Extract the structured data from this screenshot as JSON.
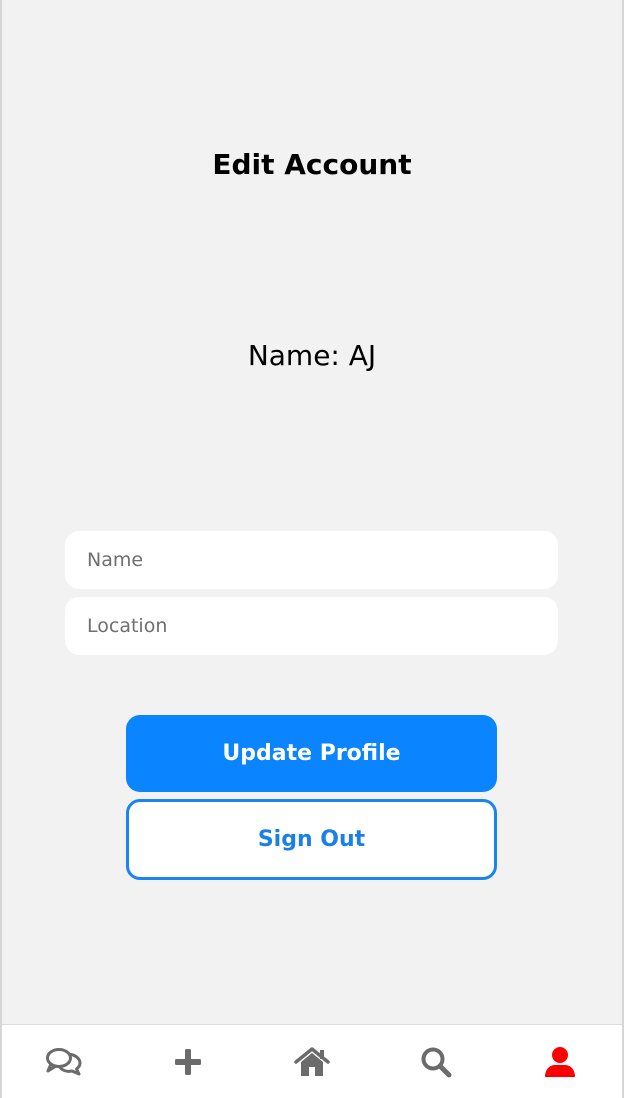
{
  "header": {
    "title": "Edit Account"
  },
  "profile": {
    "name_line": "Name: AJ"
  },
  "form": {
    "name_placeholder": "Name",
    "location_placeholder": "Location"
  },
  "actions": {
    "update_label": "Update Profile",
    "signout_label": "Sign Out"
  },
  "tabbar": {
    "items": [
      {
        "icon": "chat-bubbles-icon",
        "active": false
      },
      {
        "icon": "plus-icon",
        "active": false
      },
      {
        "icon": "home-icon",
        "active": false
      },
      {
        "icon": "search-icon",
        "active": false
      },
      {
        "icon": "user-icon",
        "active": true
      }
    ]
  },
  "colors": {
    "background": "#f2f2f2",
    "primary": "#0a84ff",
    "outline": "#1a85f0",
    "icon_inactive": "#6b6b6b",
    "icon_active": "#ff0000"
  }
}
